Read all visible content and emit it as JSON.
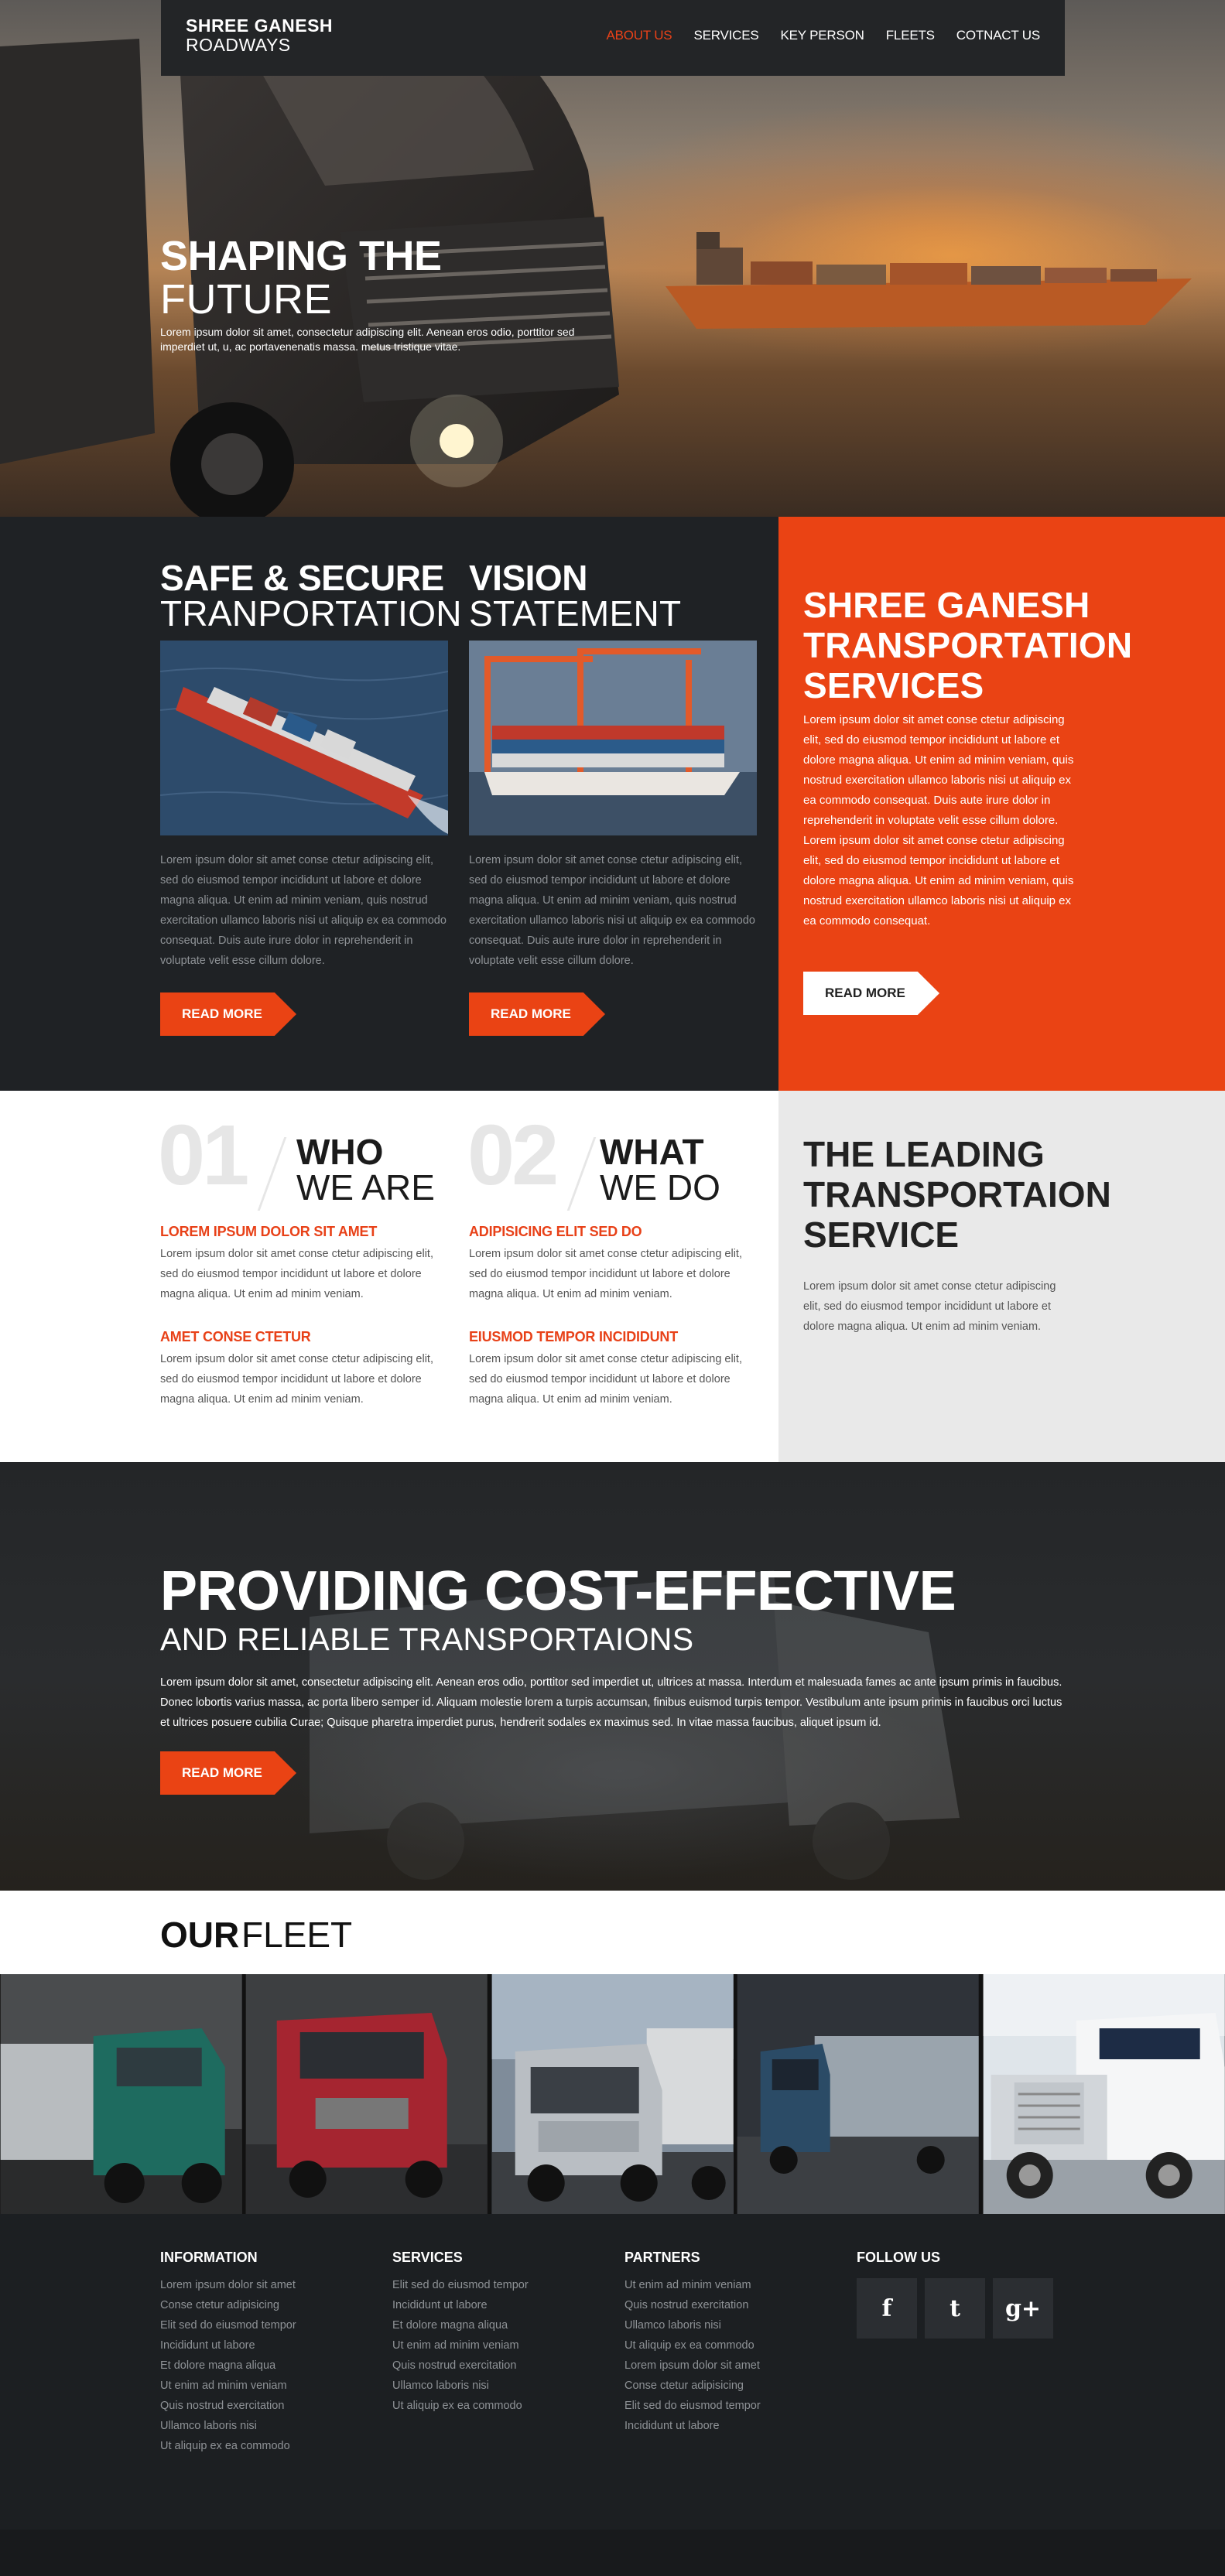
{
  "brand": {
    "line1": "SHREE GANESH",
    "line2": "ROADWAYS"
  },
  "nav": [
    {
      "label": "ABOUT US",
      "active": true
    },
    {
      "label": "SERVICES",
      "active": false
    },
    {
      "label": "KEY PERSON",
      "active": false
    },
    {
      "label": "FLEETS",
      "active": false
    },
    {
      "label": "COTNACT US",
      "active": false
    }
  ],
  "hero": {
    "title_bold": "SHAPING THE",
    "title_light": "FUTURE",
    "desc": "Lorem ipsum dolor sit amet, consectetur adipiscing elit. Aenean eros odio, porttitor sed imperdiet ut, u, ac portavenenatis massa. metus tristique vitae."
  },
  "features": [
    {
      "title_bold": "SAFE & SECURE",
      "title_light": "TRANPORTATION",
      "text": "Lorem ipsum dolor sit amet conse ctetur adipiscing elit, sed do eiusmod tempor incididunt ut labore et dolore magna aliqua. Ut enim ad minim veniam, quis nostrud exercitation ullamco laboris nisi ut aliquip ex ea commodo consequat. Duis aute irure dolor in reprehenderit in voluptate velit esse cillum dolore.",
      "button": "READ MORE"
    },
    {
      "title_bold": "VISION",
      "title_light": "STATEMENT",
      "text": "Lorem ipsum dolor sit amet conse ctetur adipiscing elit, sed do eiusmod tempor incididunt ut labore et dolore magna aliqua. Ut enim ad minim veniam, quis nostrud exercitation ullamco laboris nisi ut aliquip ex ea commodo consequat. Duis aute irure dolor in reprehenderit in voluptate velit esse cillum dolore.",
      "button": "READ MORE"
    }
  ],
  "orange_panel": {
    "title": [
      "SHREE GANESH",
      "TRANSPORTATION",
      "SERVICES"
    ],
    "text": "Lorem ipsum dolor sit amet conse ctetur adipiscing elit, sed do eiusmod tempor incididunt ut labore et dolore magna aliqua. Ut enim ad minim veniam, quis nostrud exercitation ullamco laboris nisi ut aliquip ex ea commodo consequat. Duis aute irure dolor in reprehenderit in voluptate velit esse cillum dolore. Lorem ipsum dolor sit amet conse ctetur adipiscing elit, sed do eiusmod tempor incididunt ut labore et dolore magna aliqua. Ut enim ad minim veniam, quis nostrud exercitation ullamco laboris nisi ut aliquip ex ea commodo consequat.",
    "button": "READ MORE"
  },
  "about": {
    "who": {
      "number": "01",
      "title_bold": "WHO",
      "title_light": "WE ARE",
      "items": [
        {
          "heading": "LOREM IPSUM DOLOR SIT AMET",
          "text": "Lorem ipsum dolor sit amet conse ctetur adipiscing elit, sed do eiusmod tempor incididunt ut labore et dolore magna aliqua. Ut enim ad minim veniam."
        },
        {
          "heading": "AMET CONSE CTETUR",
          "text": "Lorem ipsum dolor sit amet conse ctetur adipiscing elit, sed do eiusmod tempor incididunt ut labore et dolore magna aliqua. Ut enim ad minim veniam."
        }
      ]
    },
    "what": {
      "number": "02",
      "title_bold": "WHAT",
      "title_light": "WE DO",
      "items": [
        {
          "heading": "ADIPISICING ELIT SED DO",
          "text": "Lorem ipsum dolor sit amet conse ctetur adipiscing elit, sed do eiusmod tempor incididunt ut labore et dolore magna aliqua. Ut enim ad minim veniam."
        },
        {
          "heading": "EIUSMOD TEMPOR INCIDIDUNT",
          "text": "Lorem ipsum dolor sit amet conse ctetur adipiscing elit, sed do eiusmod tempor incididunt ut labore et dolore magna aliqua. Ut enim ad minim veniam."
        }
      ]
    },
    "leading": {
      "title": [
        "THE LEADING",
        "TRANSPORTAION",
        "SERVICE"
      ],
      "text": "Lorem ipsum dolor sit amet conse ctetur adipiscing elit, sed do eiusmod tempor incididunt ut labore et dolore magna aliqua. Ut enim ad minim veniam."
    }
  },
  "cost": {
    "title_bold": "PROVIDING COST-EFFECTIVE",
    "title_light": "AND RELIABLE TRANSPORTAIONS",
    "text": "Lorem ipsum dolor sit amet, consectetur adipiscing elit. Aenean eros odio, porttitor sed imperdiet ut, ultrices at massa. Interdum et malesuada fames ac ante ipsum primis in faucibus. Donec lobortis varius massa, ac porta libero semper id. Aliquam molestie lorem a turpis accumsan, finibus euismod turpis tempor. Vestibulum ante ipsum primis in faucibus orci luctus et ultrices posuere cubilia Curae; Quisque pharetra imperdiet purus, hendrerit sodales ex maximus sed. In vitae massa faucibus, aliquet ipsum id.",
    "button": "READ MORE"
  },
  "fleet": {
    "title_bold": "OUR",
    "title_light": "FLEET"
  },
  "footer": {
    "columns": [
      {
        "heading": "INFORMATION",
        "links": [
          "Lorem ipsum dolor sit amet",
          "Conse ctetur adipisicing",
          "Elit sed do eiusmod tempor",
          "Incididunt ut labore",
          "Et dolore magna aliqua",
          "Ut enim ad minim veniam",
          "Quis nostrud exercitation",
          "Ullamco laboris nisi",
          "Ut aliquip ex ea commodo"
        ]
      },
      {
        "heading": "SERVICES",
        "links": [
          "Elit sed do eiusmod tempor",
          "Incididunt ut labore",
          "Et dolore magna aliqua",
          "Ut enim ad minim veniam",
          "Quis nostrud exercitation",
          "Ullamco laboris nisi",
          "Ut aliquip ex ea commodo"
        ]
      },
      {
        "heading": "PARTNERS",
        "links": [
          "Ut enim ad minim veniam",
          "Quis nostrud exercitation",
          "Ullamco laboris nisi",
          "Ut aliquip ex ea commodo",
          "Lorem ipsum dolor sit amet",
          "Conse ctetur adipisicing",
          "Elit sed do eiusmod tempor",
          "Incididunt ut labore"
        ]
      }
    ],
    "follow": {
      "heading": "FOLLOW US",
      "icons": [
        {
          "name": "facebook-icon",
          "glyph": "f"
        },
        {
          "name": "twitter-icon",
          "glyph": "t"
        },
        {
          "name": "google-plus-icon",
          "glyph": "g+"
        }
      ]
    }
  },
  "colors": {
    "accent": "#ea4314",
    "dark": "#1f2225",
    "grey_panel": "#e9e9e9"
  }
}
